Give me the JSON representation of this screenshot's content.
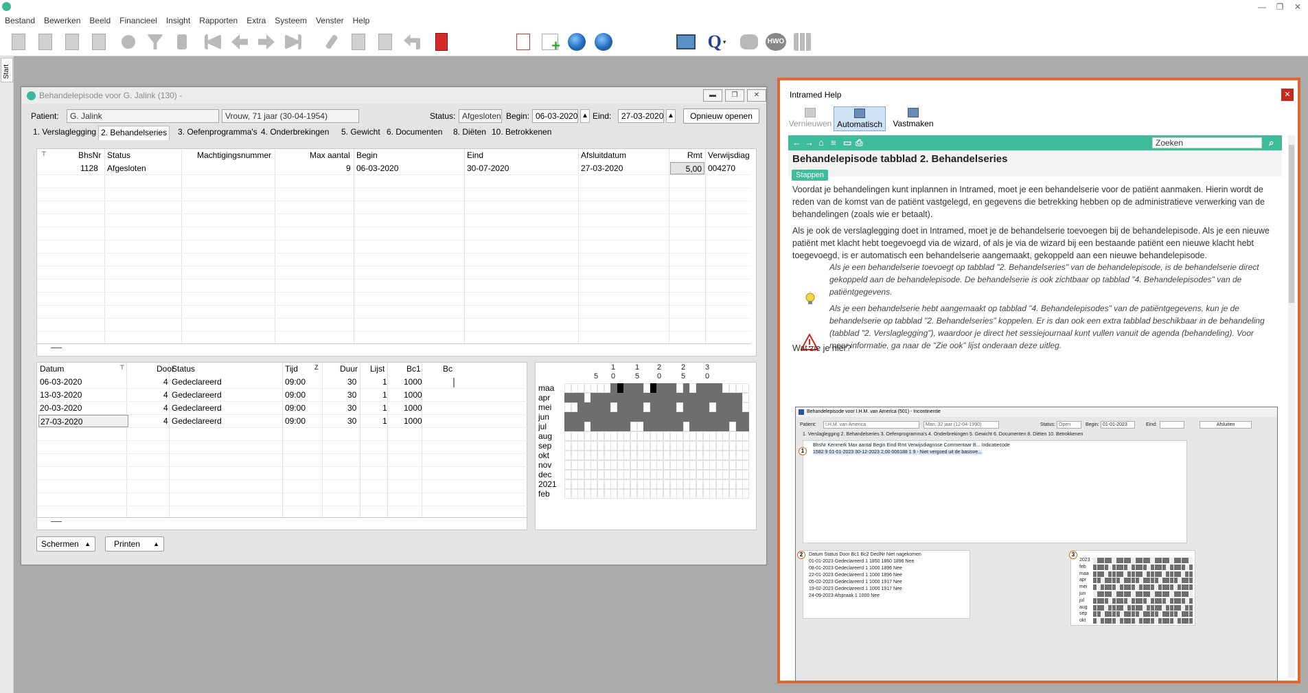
{
  "menubar": [
    "Bestand",
    "Bewerken",
    "Beeld",
    "Financieel",
    "Insight",
    "Rapporten",
    "Extra",
    "Systeem",
    "Venster",
    "Help"
  ],
  "sidebar_tab": "Start",
  "episode_window": {
    "title": "Behandelepisode voor G. Jalink (130) -",
    "patient_label": "Patient:",
    "patient_name": "G. Jalink",
    "patient_info": "Vrouw, 71 jaar (30-04-1954)",
    "status_label": "Status:",
    "status_value": "Afgesloten",
    "begin_label": "Begin:",
    "begin_value": "06-03-2020",
    "eind_label": "Eind:",
    "eind_value": "27-03-2020",
    "reopen_button": "Opnieuw openen",
    "tabs": [
      "1. Verslaglegging",
      "2. Behandelseries",
      "3. Oefenprogramma's",
      "4. Onderbrekingen",
      "5. Gewicht",
      "6. Documenten",
      "8. Diëten",
      "10. Betrokkenen"
    ],
    "series_columns": [
      "BhsNr",
      "Status",
      "Machtigingsnummer",
      "Max aantal",
      "Begin",
      "Eind",
      "Afsluitdatum",
      "Rmt",
      "Verwijsdiag"
    ],
    "series_rows": [
      {
        "bhsnr": "1128",
        "status": "Afgesloten",
        "machtiging": "",
        "max": "9",
        "begin": "06-03-2020",
        "eind": "30-07-2020",
        "afsluit": "27-03-2020",
        "rmt": "5,00",
        "verwijs": "004270"
      }
    ],
    "treat_columns": [
      "Datum",
      "Door",
      "Status",
      "Tijd",
      "Duur",
      "Lijst",
      "Bc1",
      "Bc"
    ],
    "treat_rows": [
      {
        "datum": "06-03-2020",
        "door": "4",
        "status": "Gedeclareerd",
        "tijd": "09:00",
        "duur": "30",
        "lijst": "1",
        "bc1": "1000"
      },
      {
        "datum": "13-03-2020",
        "door": "4",
        "status": "Gedeclareerd",
        "tijd": "09:00",
        "duur": "30",
        "lijst": "1",
        "bc1": "1000"
      },
      {
        "datum": "20-03-2020",
        "door": "4",
        "status": "Gedeclareerd",
        "tijd": "09:00",
        "duur": "30",
        "lijst": "1",
        "bc1": "1000"
      },
      {
        "datum": "27-03-2020",
        "door": "4",
        "status": "Gedeclareerd",
        "tijd": "09:00",
        "duur": "30",
        "lijst": "1",
        "bc1": "1000"
      }
    ],
    "calendar_day_headers": [
      [
        "",
        ""
      ],
      [
        "",
        "5"
      ],
      [
        "1",
        "0"
      ],
      [
        "1",
        "5"
      ],
      [
        "2",
        "0"
      ],
      [
        "2",
        "5"
      ],
      [
        "3",
        "0"
      ]
    ],
    "calendar_months": [
      "maa",
      "apr",
      "mei",
      "jun",
      "jul",
      "aug",
      "sep",
      "okt",
      "nov",
      "dec",
      "2021",
      "feb"
    ],
    "schermen_button": "Schermen",
    "printen_button": "Printen"
  },
  "help": {
    "window_title": "Intramed Help",
    "buttons": [
      "Vernieuwen",
      "Automatisch",
      "Vastmaken"
    ],
    "search_placeholder": "Zoeken",
    "page_title": "Behandelepisode tabblad 2. Behandelseries",
    "badge": "Stappen",
    "para1": "Voordat je behandelingen kunt inplannen in Intramed, moet je een behandelserie voor de patiënt aanmaken. Hierin wordt de reden van de komst van de patiënt vastgelegd, en gegevens die betrekking hebben op de administratieve verwerking van de behandelingen (zoals wie er betaalt).",
    "para2": "Als je ook de verslaglegging doet in Intramed, moet je de behandelserie toevoegen bij de behandelepisode. Als je een nieuwe patiënt met klacht hebt toegevoegd via de wizard, of als je via de wizard bij een bestaande patiënt een nieuwe klacht hebt toegevoegd, is er automatisch een behandelserie aangemaakt, gekoppeld aan een nieuwe behandelepisode.",
    "tip": "Als je een  behandelserie toevoegt op tabblad \"2. Behandelseries\" van de behandelepisode, is de  behandelserie direct gekoppeld aan de behandelepisode. De  behandelserie is ook zichtbaar op tabblad \"4. Behandelepisodes\" van de patiëntgegevens.",
    "warning": "Als je een  behandelserie hebt aangemaakt op tabblad \"4. Behandelepisodes\" van de patiëntgegevens, kun je de behandelserie op tabblad \"2. Behandelseries\" koppelen. Er  is dan ook een extra tabblad beschikbaar in de behandeling (tabblad \"2. Verslaglegging\"), waardoor je direct het sessiejournaal kunt vullen vanuit de agenda (behandeling). Voor meer informatie,  ga naar  de  \"Zie ook\" lijst onderaan deze uitleg.",
    "question": "Wat zie je hier?",
    "mini": {
      "title": "Behandelepisode voor I.H.M. van America (501) - Incontinentie",
      "patient_label": "Patient:",
      "patient": "I.H.M. van America",
      "info": "Man, 32 jaar (12-04-1990)",
      "status_label": "Status:",
      "status": "Open",
      "begin_label": "Begin:",
      "begin": "01-01-2023",
      "eind_label": "Eind:",
      "close_btn": "Afsluiten",
      "tabs": "1. Verslaglegging   2. Behandelseries   3. Oefenprogramma's   4. Onderbrekingen   5. Gewicht   6. Documenten   8. Diëten   10. Betrokkenen",
      "series_header": "BhsNr   Kenmerk   Max aantal   Begin   Eind   Rmt   Verwijsdiagnose   Commentaar   B...   Indicatiecode",
      "series_row": "1582   9   01-01-2023   30-12-2023   2,00   006188   1   9 - Niet vergoed uit de basisve...",
      "treat_header": "Datum   Status   Door   Bc1   Bc2   DeclNr   Niet nagekomen",
      "treat_rows": [
        "01-01-2023   Gedeclareerd   1   1850   1860   1896   Nee",
        "08-01-2023   Gedeclareerd   1   1000   1896   Nee",
        "22-01-2023   Gedeclareerd   1   1000   1896   Nee",
        "05-02-2023   Gedeclareerd   1   1000   1917   Nee",
        "19-02-2023   Gedeclareerd   1   1000   1917   Nee",
        "24-09-2023   Afspraak   1   1000   Nee"
      ],
      "cal_months": [
        "2023",
        "feb",
        "maa",
        "apr",
        "mei",
        "jun",
        "jul",
        "aug",
        "sep",
        "okt"
      ],
      "callouts": [
        "1",
        "2",
        "3"
      ]
    }
  },
  "colors": {
    "accent": "#3dbd9a",
    "help_border": "#e0672f",
    "selected_day": "#3d7fd9"
  }
}
